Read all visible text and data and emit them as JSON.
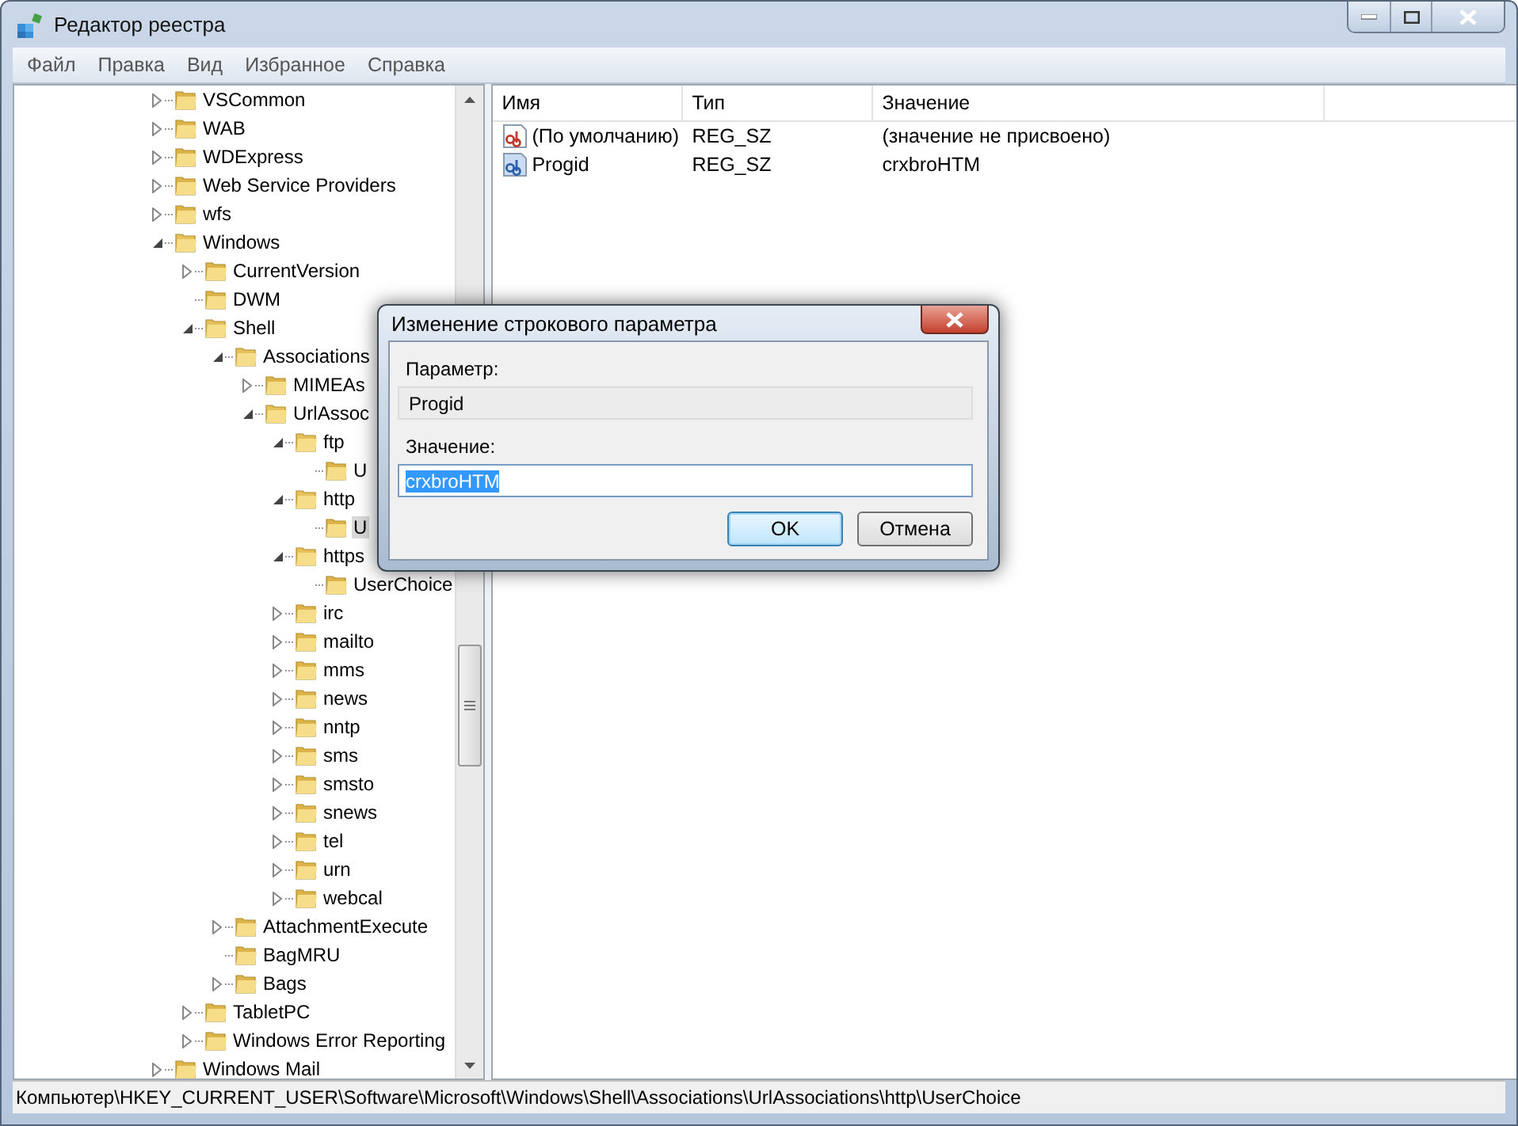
{
  "window": {
    "title": "Редактор реестра"
  },
  "menu": [
    "Файл",
    "Правка",
    "Вид",
    "Избранное",
    "Справка"
  ],
  "tree": [
    {
      "label": "VSCommon",
      "expanded": false,
      "leaf": false,
      "selected": false
    },
    {
      "label": "WAB",
      "expanded": false,
      "leaf": false,
      "selected": false
    },
    {
      "label": "WDExpress",
      "expanded": false,
      "leaf": false,
      "selected": false
    },
    {
      "label": "Web Service Providers",
      "expanded": false,
      "leaf": false,
      "selected": false
    },
    {
      "label": "wfs",
      "expanded": false,
      "leaf": false,
      "selected": false
    },
    {
      "label": "Windows",
      "expanded": true,
      "leaf": false,
      "selected": false,
      "children": [
        {
          "label": "CurrentVersion",
          "expanded": false,
          "leaf": false,
          "selected": false
        },
        {
          "label": "DWM",
          "leaf": true,
          "selected": false
        },
        {
          "label": "Shell",
          "expanded": true,
          "leaf": false,
          "selected": false,
          "children": [
            {
              "label": "Associations",
              "expanded": true,
              "leaf": false,
              "selected": false,
              "children": [
                {
                  "label": "MIMEAs",
                  "expanded": false,
                  "leaf": false,
                  "selected": false
                },
                {
                  "label": "UrlAssoc",
                  "expanded": true,
                  "leaf": false,
                  "selected": false,
                  "children": [
                    {
                      "label": "ftp",
                      "expanded": true,
                      "leaf": false,
                      "selected": false,
                      "children": [
                        {
                          "label": "U",
                          "leaf": true,
                          "selected": false
                        }
                      ]
                    },
                    {
                      "label": "http",
                      "expanded": true,
                      "leaf": false,
                      "selected": false,
                      "children": [
                        {
                          "label": "U",
                          "leaf": true,
                          "selected": true
                        }
                      ]
                    },
                    {
                      "label": "https",
                      "expanded": true,
                      "leaf": false,
                      "selected": false,
                      "children": [
                        {
                          "label": "UserChoice",
                          "leaf": true,
                          "selected": false
                        }
                      ]
                    },
                    {
                      "label": "irc",
                      "expanded": false,
                      "leaf": false,
                      "selected": false
                    },
                    {
                      "label": "mailto",
                      "expanded": false,
                      "leaf": false,
                      "selected": false
                    },
                    {
                      "label": "mms",
                      "expanded": false,
                      "leaf": false,
                      "selected": false
                    },
                    {
                      "label": "news",
                      "expanded": false,
                      "leaf": false,
                      "selected": false
                    },
                    {
                      "label": "nntp",
                      "expanded": false,
                      "leaf": false,
                      "selected": false
                    },
                    {
                      "label": "sms",
                      "expanded": false,
                      "leaf": false,
                      "selected": false
                    },
                    {
                      "label": "smsto",
                      "expanded": false,
                      "leaf": false,
                      "selected": false
                    },
                    {
                      "label": "snews",
                      "expanded": false,
                      "leaf": false,
                      "selected": false
                    },
                    {
                      "label": "tel",
                      "expanded": false,
                      "leaf": false,
                      "selected": false
                    },
                    {
                      "label": "urn",
                      "expanded": false,
                      "leaf": false,
                      "selected": false
                    },
                    {
                      "label": "webcal",
                      "expanded": false,
                      "leaf": false,
                      "selected": false
                    }
                  ]
                }
              ]
            },
            {
              "label": "AttachmentExecute",
              "expanded": false,
              "leaf": false,
              "selected": false
            },
            {
              "label": "BagMRU",
              "leaf": true,
              "selected": false
            },
            {
              "label": "Bags",
              "expanded": false,
              "leaf": false,
              "selected": false
            }
          ]
        },
        {
          "label": "TabletPC",
          "expanded": false,
          "leaf": false,
          "selected": false
        },
        {
          "label": "Windows Error Reporting",
          "expanded": false,
          "leaf": false,
          "selected": false
        }
      ]
    },
    {
      "label": "Windows Mail",
      "expanded": false,
      "leaf": false,
      "selected": false
    }
  ],
  "values": {
    "columns": [
      "Имя",
      "Тип",
      "Значение"
    ],
    "rows": [
      {
        "name": "(По умолчанию)",
        "type": "REG_SZ",
        "data": "(значение не присвоено)",
        "selected": false
      },
      {
        "name": "Progid",
        "type": "REG_SZ",
        "data": "crxbroHTM",
        "selected": true
      }
    ]
  },
  "dialog": {
    "title": "Изменение строкового параметра",
    "name_label": "Параметр:",
    "name_value": "Progid",
    "value_label": "Значение:",
    "value": "crxbroHTM",
    "buttons": [
      {
        "label": "OK",
        "default": true
      },
      {
        "label": "Отмена",
        "default": false
      }
    ]
  },
  "status_bar": "Компьютер\\HKEY_CURRENT_USER\\Software\\Microsoft\\Windows\\Shell\\Associations\\UrlAssociations\\http\\UserChoice"
}
